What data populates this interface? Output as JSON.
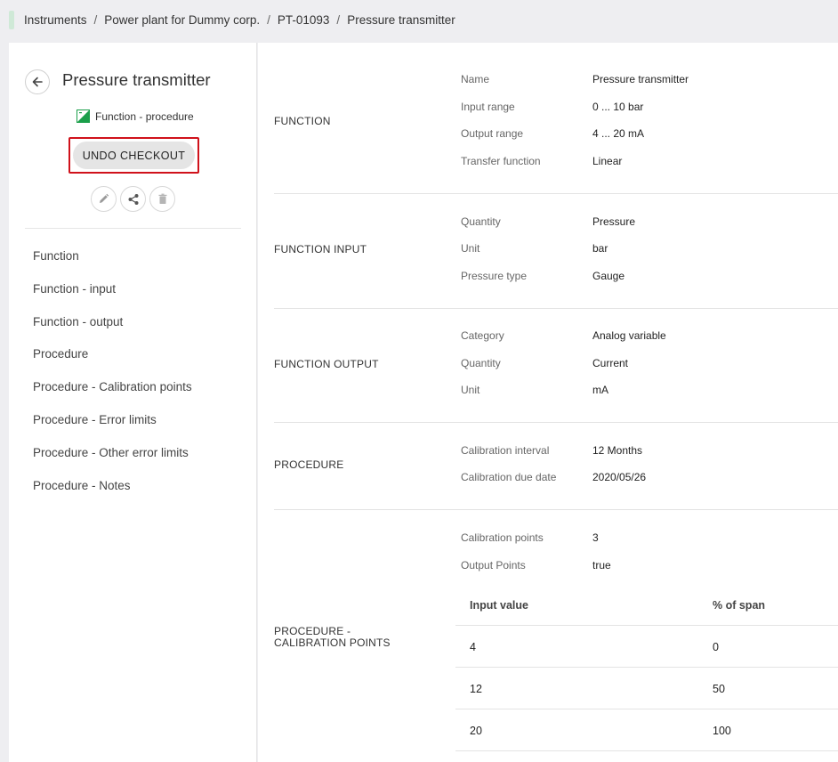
{
  "breadcrumb": {
    "items": [
      "Instruments",
      "Power plant for Dummy corp.",
      "PT-01093",
      "Pressure transmitter"
    ],
    "separator": "/"
  },
  "sidebar": {
    "title": "Pressure transmitter",
    "type_label": "Function - procedure",
    "undo_label": "UNDO CHECKOUT",
    "actions": [
      "pencil-icon",
      "share-icon",
      "trash-icon"
    ],
    "nav": [
      "Function",
      "Function - input",
      "Function - output",
      "Procedure",
      "Procedure - Calibration points",
      "Procedure - Error limits",
      "Procedure - Other error limits",
      "Procedure - Notes"
    ]
  },
  "sections": {
    "function": {
      "title": "FUNCTION",
      "fields": [
        {
          "label": "Name",
          "value": "Pressure transmitter"
        },
        {
          "label": "Input range",
          "value": "0 ... 10 bar"
        },
        {
          "label": "Output range",
          "value": "4 ... 20 mA"
        },
        {
          "label": "Transfer function",
          "value": "Linear"
        }
      ]
    },
    "function_input": {
      "title": "FUNCTION INPUT",
      "fields": [
        {
          "label": "Quantity",
          "value": "Pressure"
        },
        {
          "label": "Unit",
          "value": "bar"
        },
        {
          "label": "Pressure type",
          "value": "Gauge"
        }
      ]
    },
    "function_output": {
      "title": "FUNCTION OUTPUT",
      "fields": [
        {
          "label": "Category",
          "value": "Analog variable"
        },
        {
          "label": "Quantity",
          "value": "Current"
        },
        {
          "label": "Unit",
          "value": "mA"
        }
      ]
    },
    "procedure": {
      "title": "PROCEDURE",
      "fields": [
        {
          "label": "Calibration interval",
          "value": "12 Months"
        },
        {
          "label": "Calibration due date",
          "value": "2020/05/26"
        }
      ]
    },
    "calibration": {
      "title_line1": "PROCEDURE -",
      "title_line2": "CALIBRATION POINTS",
      "fields": [
        {
          "label": "Calibration points",
          "value": "3"
        },
        {
          "label": "Output Points",
          "value": "true"
        }
      ],
      "table": {
        "headers": [
          "Input value",
          "% of span"
        ],
        "rows": [
          [
            "4",
            "0"
          ],
          [
            "12",
            "50"
          ],
          [
            "20",
            "100"
          ]
        ]
      }
    }
  },
  "colors": {
    "highlight": "#d0121b",
    "type_icon": "#1a9f4a"
  }
}
